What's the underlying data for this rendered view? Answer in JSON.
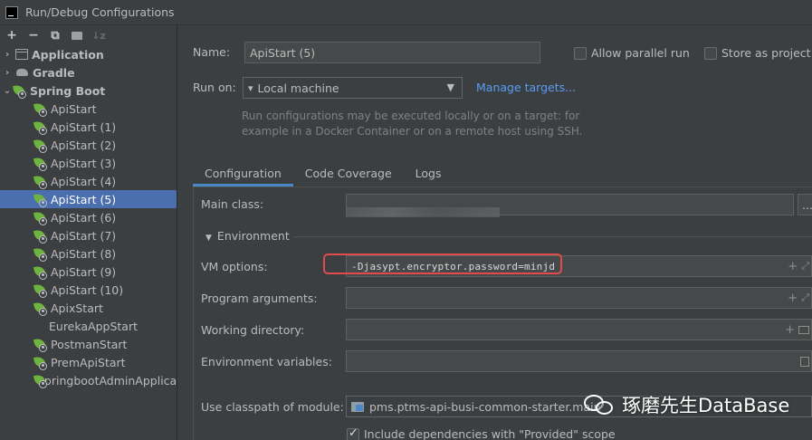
{
  "window": {
    "title": "Run/Debug Configurations"
  },
  "toolbar": {
    "add": "+",
    "remove": "−",
    "copy": "⧉",
    "new_folder": "▸",
    "sort": "↓z"
  },
  "tree": {
    "groups": [
      {
        "label": "Application",
        "expanded": false
      },
      {
        "label": "Gradle",
        "expanded": false
      },
      {
        "label": "Spring Boot",
        "expanded": true
      }
    ],
    "items": [
      "ApiStart",
      "ApiStart (1)",
      "ApiStart (2)",
      "ApiStart (3)",
      "ApiStart (4)",
      "ApiStart (5)",
      "ApiStart (6)",
      "ApiStart (7)",
      "ApiStart (8)",
      "ApiStart (9)",
      "ApiStart (10)",
      "ApixStart",
      "EurekaAppStart",
      "PostmanStart",
      "PremApiStart",
      "SpringbootAdminApplica"
    ],
    "selected": "ApiStart (5)"
  },
  "form": {
    "name_label": "Name:",
    "name_value": "ApiStart (5)",
    "allow_parallel_label": "Allow parallel run",
    "store_project_label": "Store as project f",
    "run_on_label": "Run on:",
    "run_on_value": "Local machine",
    "manage_targets": "Manage targets...",
    "hint": "Run configurations may be executed locally or on a target: for example in a Docker Container or on a remote host using SSH."
  },
  "tabs": [
    "Configuration",
    "Code Coverage",
    "Logs"
  ],
  "config": {
    "main_class_label": "Main class:",
    "main_class_button": "...",
    "environment_label": "Environment",
    "vm_options_label": "VM options:",
    "vm_options_value": "-Djasypt.encryptor.password=minjd",
    "program_args_label": "Program arguments:",
    "working_dir_label": "Working directory:",
    "env_vars_label": "Environment variables:",
    "classpath_label": "Use classpath of module:",
    "classpath_value": "pms.ptms-api-busi-common-starter.main",
    "include_deps_label": "Include dependencies with \"Provided\" scope"
  },
  "watermark": {
    "text": "琢磨先生DataBase"
  },
  "colors": {
    "background": "#3c3f41",
    "selection": "#4b6eaf",
    "link": "#589df6",
    "highlight": "#e04b4b",
    "spring": "#6db33f"
  }
}
